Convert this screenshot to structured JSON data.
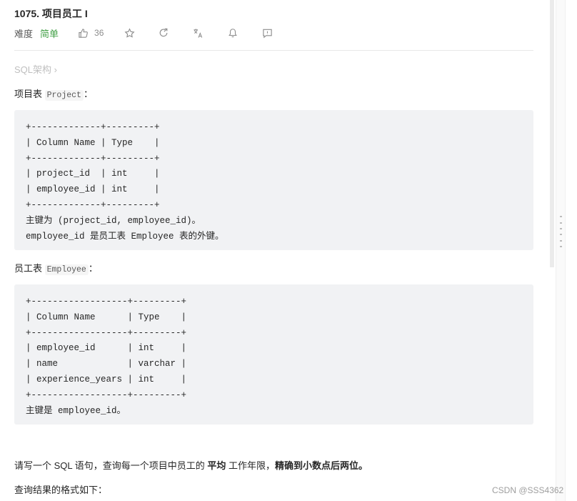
{
  "problem": {
    "title": "1075. 项目员工 I",
    "difficulty_label": "难度",
    "difficulty": "简单",
    "likes": "36",
    "icons": [
      "thumbs-up-icon",
      "star-icon",
      "share-icon",
      "translate-icon",
      "bell-icon",
      "feedback-icon"
    ]
  },
  "breadcrumb": {
    "label": "SQL架构 ›"
  },
  "project_table": {
    "intro_prefix": "项目表 ",
    "intro_code": "Project",
    "intro_suffix": "：",
    "code": "+-------------+---------+\n| Column Name | Type    |\n+-------------+---------+\n| project_id  | int     |\n| employee_id | int     |\n+-------------+---------+\n主键为 (project_id, employee_id)。\nemployee_id 是员工表 Employee 表的外键。"
  },
  "employee_table": {
    "intro_prefix": "员工表 ",
    "intro_code": "Employee",
    "intro_suffix": "：",
    "code": "+------------------+---------+\n| Column Name      | Type    |\n+------------------+---------+\n| employee_id      | int     |\n| name             | varchar |\n| experience_years | int     |\n+------------------+---------+\n主键是 employee_id。"
  },
  "question": {
    "part1": "请写一个 SQL 语句，查询每一个项目中员工的 ",
    "bold1": "平均",
    "part2": " 工作年限，",
    "bold2": "精确到小数点后两位。"
  },
  "result_format": "查询结果的格式如下：",
  "watermark": "CSDN @SSS4362"
}
